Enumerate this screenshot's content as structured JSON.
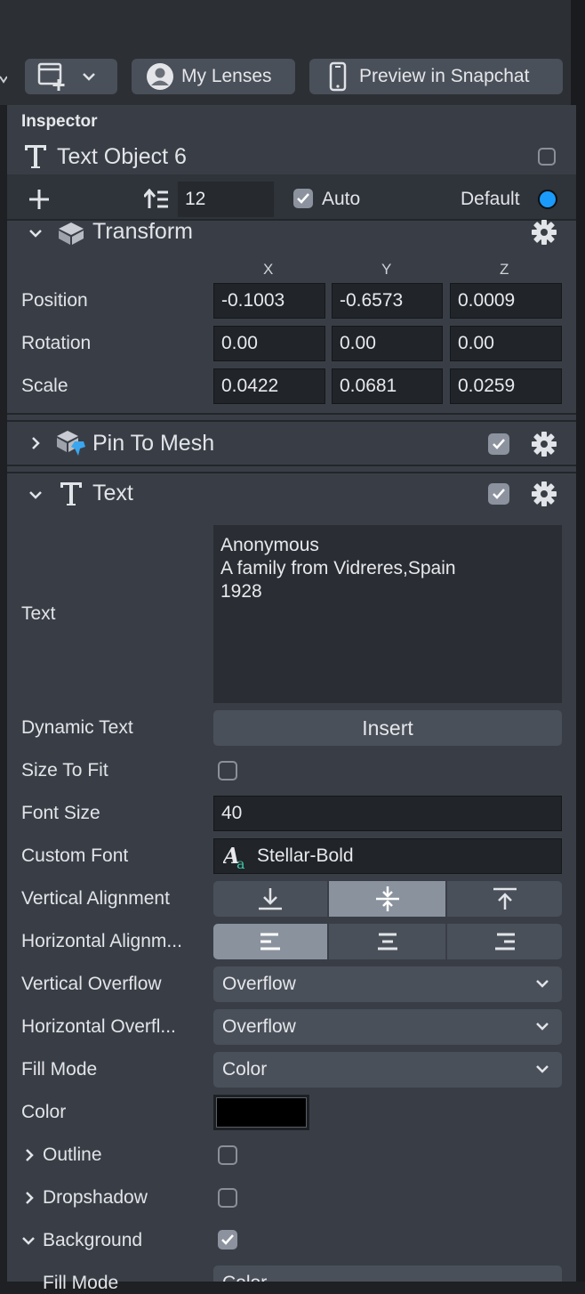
{
  "toolbar": {
    "my_lenses_label": "My Lenses",
    "preview_label": "Preview in Snapchat"
  },
  "inspector": {
    "title": "Inspector",
    "object_name": "Text Object 6",
    "layer_value": "12",
    "auto_label": "Auto",
    "default_label": "Default",
    "accent_color": "#1a9bfc"
  },
  "transform": {
    "title": "Transform",
    "axes": [
      "X",
      "Y",
      "Z"
    ],
    "position_label": "Position",
    "rotation_label": "Rotation",
    "scale_label": "Scale",
    "position": [
      "-0.1003",
      "-0.6573",
      "0.0009"
    ],
    "rotation": [
      "0.00",
      "0.00",
      "0.00"
    ],
    "scale": [
      "0.0422",
      "0.0681",
      "0.0259"
    ]
  },
  "pin_to_mesh": {
    "title": "Pin To Mesh"
  },
  "text_component": {
    "title": "Text",
    "text_label": "Text",
    "text_lines": [
      "Anonymous",
      "A family from Vidreres,Spain",
      "1928"
    ],
    "dynamic_text_label": "Dynamic Text",
    "insert_label": "Insert",
    "size_to_fit_label": "Size To Fit",
    "font_size_label": "Font Size",
    "font_size_value": "40",
    "custom_font_label": "Custom Font",
    "custom_font_value": "Stellar-Bold",
    "vertical_alignment_label": "Vertical Alignment",
    "horizontal_alignment_label": "Horizontal Alignm...",
    "vertical_overflow_label": "Vertical Overflow",
    "vertical_overflow_value": "Overflow",
    "horizontal_overflow_label": "Horizontal Overfl...",
    "horizontal_overflow_value": "Overflow",
    "fill_mode_label": "Fill Mode",
    "fill_mode_value": "Color",
    "color_label": "Color",
    "color_value": "#000000",
    "outline_label": "Outline",
    "dropshadow_label": "Dropshadow",
    "background_label": "Background",
    "bg_fill_mode_label": "Fill Mode",
    "bg_fill_mode_value": "Color"
  }
}
